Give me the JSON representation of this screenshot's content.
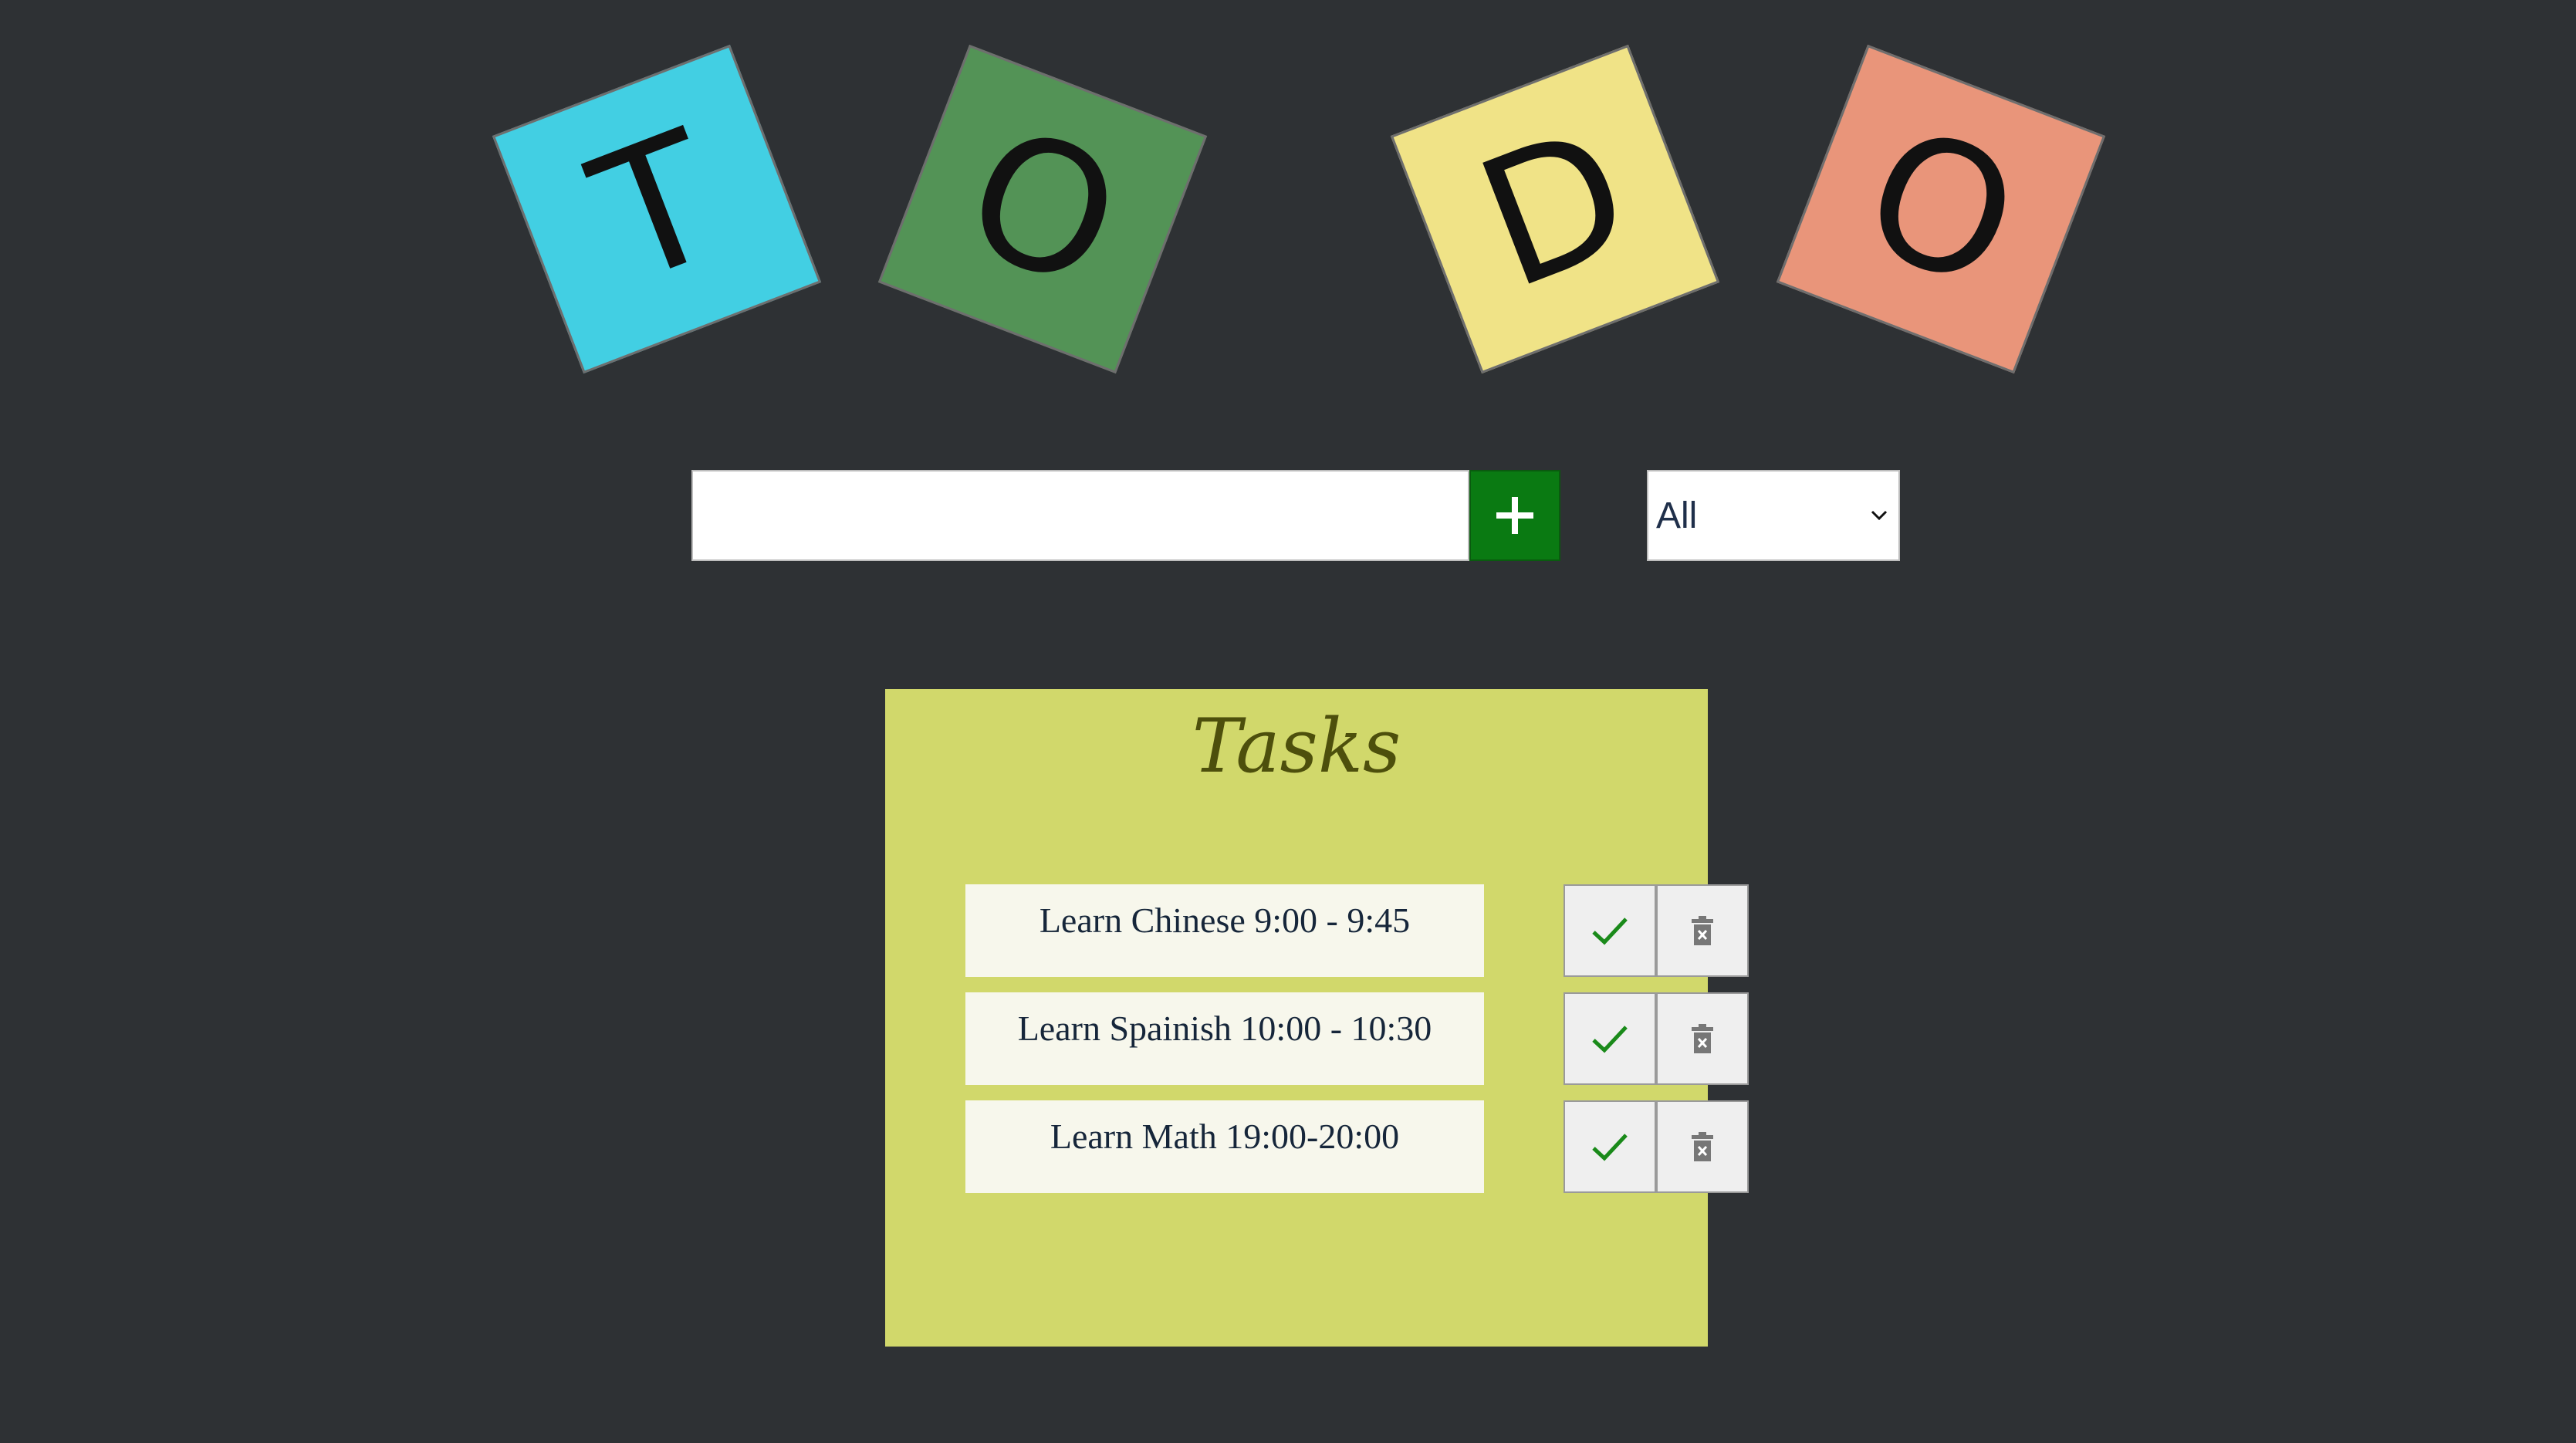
{
  "header": {
    "tiles": [
      {
        "letter": "T",
        "color": "#42cfe3"
      },
      {
        "letter": "O",
        "color": "#539356"
      },
      {
        "letter": "D",
        "color": "#f0e387"
      },
      {
        "letter": "O",
        "color": "#e9957a"
      }
    ]
  },
  "form": {
    "input_value": "",
    "input_placeholder": "",
    "add_icon": "plus-icon",
    "filter_selected": "All",
    "filter_icon": "chevron-down-icon"
  },
  "tasks": {
    "title": "Tasks",
    "items": [
      {
        "text": "Learn Chinese 9:00 - 9:45",
        "complete_icon": "check-icon",
        "delete_icon": "trash-icon"
      },
      {
        "text": "Learn Spainish 10:00 - 10:30",
        "complete_icon": "check-icon",
        "delete_icon": "trash-icon"
      },
      {
        "text": "Learn Math 19:00-20:00",
        "complete_icon": "check-icon",
        "delete_icon": "trash-icon"
      }
    ]
  },
  "colors": {
    "background": "#2e3134",
    "add_button": "#0a7a12",
    "panel": "#d1d86b",
    "check": "#1a8a1a"
  }
}
